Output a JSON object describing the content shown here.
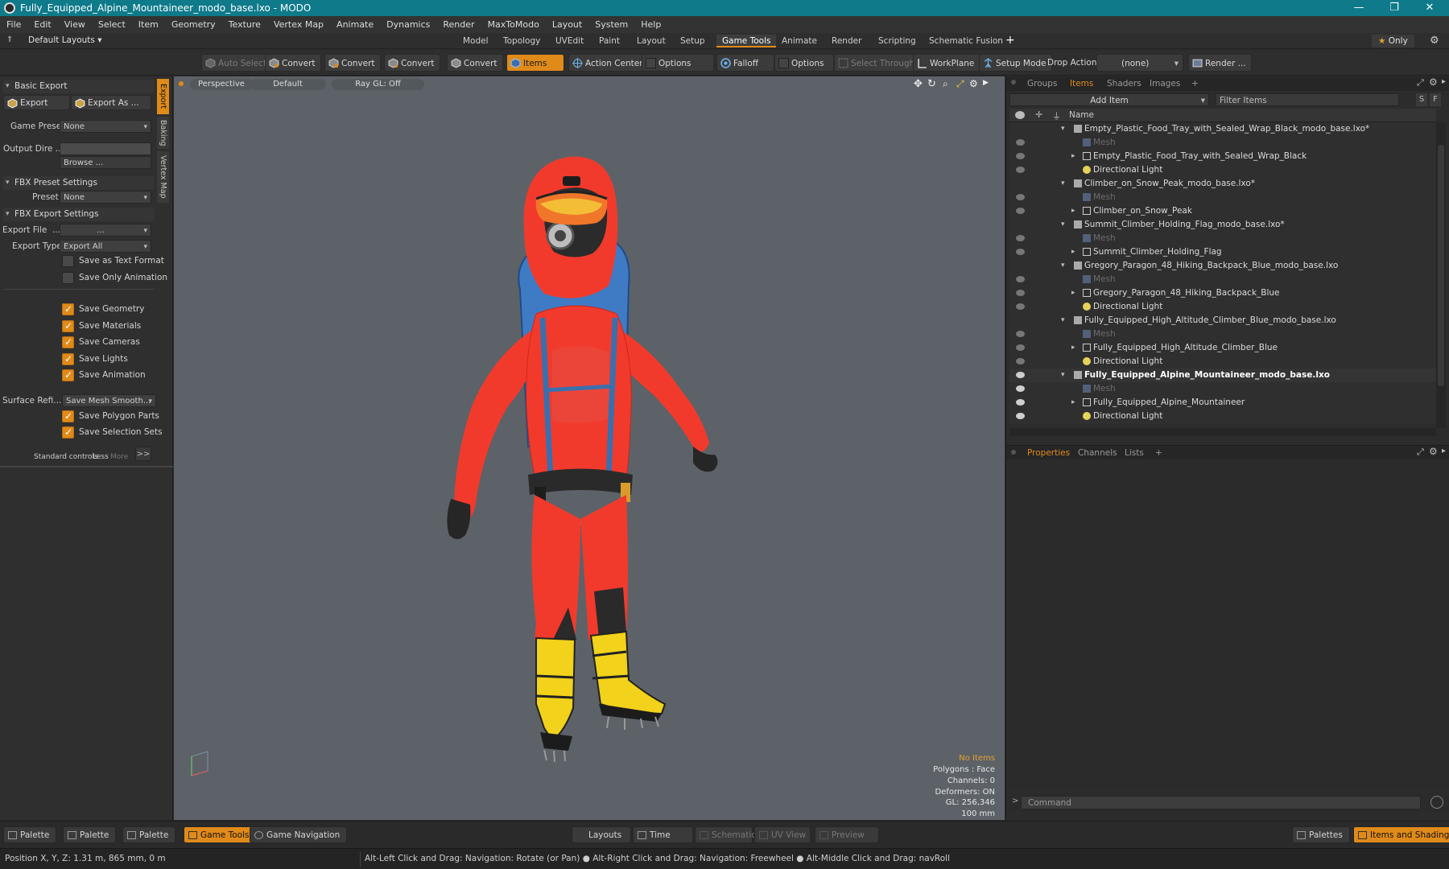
{
  "window": {
    "title": "Fully_Equipped_Alpine_Mountaineer_modo_base.lxo - MODO",
    "controls": [
      "—",
      "❐",
      "✕"
    ]
  },
  "menu": [
    "File",
    "Edit",
    "View",
    "Select",
    "Item",
    "Geometry",
    "Texture",
    "Vertex Map",
    "Animate",
    "Dynamics",
    "Render",
    "MaxToModo",
    "Layout",
    "System",
    "Help"
  ],
  "layouts": {
    "dropdown": "Default Layouts",
    "tabs": [
      "Model",
      "Topology",
      "UVEdit",
      "Paint",
      "Layout",
      "Setup",
      "Game Tools",
      "Animate",
      "Render",
      "Scripting",
      "Schematic Fusion"
    ],
    "active_tab": "Game Tools",
    "only": "Only"
  },
  "toolbar": {
    "auto_select": "Auto Select",
    "convert": "Convert",
    "items": "Items",
    "action_center": "Action Center",
    "options": "Options",
    "falloff": "Falloff",
    "select_through": "Select Through",
    "workplane": "WorkPlane",
    "setup_mode": "Setup Mode",
    "drop_action": "Drop Action",
    "drop_value": "(none)",
    "render": "Render ..."
  },
  "left": {
    "basic_export": "Basic Export",
    "export_btn": "Export",
    "export_as_btn": "Export As ...",
    "game_preset_label": "Game Preset",
    "game_preset_value": "None",
    "output_dir_label": "Output Dire ...",
    "browse": "Browse ...",
    "fbx_preset_settings": "FBX Preset Settings",
    "preset_label": "Preset",
    "preset_value": "None",
    "fbx_export_settings": "FBX Export Settings",
    "export_file_label": "Export File",
    "export_file_value": "...",
    "export_type_label": "Export Type",
    "export_type_value": "Export All",
    "save_text_format": "Save as Text Format",
    "save_only_animation": "Save Only Animation",
    "save_geometry": "Save Geometry",
    "save_materials": "Save Materials",
    "save_cameras": "Save Cameras",
    "save_lights": "Save Lights",
    "save_animation": "Save Animation",
    "surface_label": "Surface Refi...",
    "surface_value": "Save Mesh Smooth...",
    "save_polygon_parts": "Save Polygon Parts",
    "save_selection_sets": "Save Selection Sets",
    "standard_controls": "Standard controls",
    "less": "Less",
    "more": "More",
    "vtabs": [
      "Export",
      "Baking",
      "Vertex Map"
    ]
  },
  "viewport": {
    "view": "Perspective",
    "style": "Default",
    "raygl": "Ray GL: Off",
    "info": {
      "no_items": "No Items",
      "polygons": "Polygons : Face",
      "channels": "Channels: 0",
      "deformers": "Deformers: ON",
      "gl": "GL: 256,346",
      "scale": "100 mm"
    }
  },
  "right": {
    "tabs": [
      "Groups",
      "Items",
      "Shaders",
      "Images"
    ],
    "active_tab": "Items",
    "add_item": "Add Item",
    "filter_items": "Filter Items",
    "name_header": "Name",
    "tree": [
      {
        "label": "Empty_Plastic_Food_Tray_with_Sealed_Wrap_Black_modo_base.lxo*",
        "level": 0,
        "type": "scene"
      },
      {
        "label": "Mesh",
        "level": 1,
        "type": "mesh"
      },
      {
        "label": "Empty_Plastic_Food_Tray_with_Sealed_Wrap_Black",
        "level": 1,
        "type": "group"
      },
      {
        "label": "Directional Light",
        "level": 1,
        "type": "light"
      },
      {
        "label": "Climber_on_Snow_Peak_modo_base.lxo*",
        "level": 0,
        "type": "scene"
      },
      {
        "label": "Mesh",
        "level": 1,
        "type": "mesh"
      },
      {
        "label": "Climber_on_Snow_Peak",
        "level": 1,
        "type": "group"
      },
      {
        "label": "Summit_Climber_Holding_Flag_modo_base.lxo*",
        "level": 0,
        "type": "scene"
      },
      {
        "label": "Mesh",
        "level": 1,
        "type": "mesh"
      },
      {
        "label": "Summit_Climber_Holding_Flag",
        "level": 1,
        "type": "group"
      },
      {
        "label": "Gregory_Paragon_48_Hiking_Backpack_Blue_modo_base.lxo",
        "level": 0,
        "type": "scene"
      },
      {
        "label": "Mesh",
        "level": 1,
        "type": "mesh"
      },
      {
        "label": "Gregory_Paragon_48_Hiking_Backpack_Blue",
        "level": 1,
        "type": "group"
      },
      {
        "label": "Directional Light",
        "level": 1,
        "type": "light"
      },
      {
        "label": "Fully_Equipped_High_Altitude_Climber_Blue_modo_base.lxo",
        "level": 0,
        "type": "scene"
      },
      {
        "label": "Mesh",
        "level": 1,
        "type": "mesh"
      },
      {
        "label": "Fully_Equipped_High_Altitude_Climber_Blue",
        "level": 1,
        "type": "group"
      },
      {
        "label": "Directional Light",
        "level": 1,
        "type": "light"
      },
      {
        "label": "Fully_Equipped_Alpine_Mountaineer_modo_base.lxo",
        "level": 0,
        "type": "scene",
        "bold": true
      },
      {
        "label": "Mesh",
        "level": 1,
        "type": "mesh"
      },
      {
        "label": "Fully_Equipped_Alpine_Mountaineer",
        "level": 1,
        "type": "group"
      },
      {
        "label": "Directional Light",
        "level": 1,
        "type": "light"
      }
    ],
    "prop_tabs": [
      "Properties",
      "Channels",
      "Lists"
    ],
    "command_placeholder": "Command"
  },
  "bottom": {
    "palette": "Palette",
    "game_tools": "Game Tools",
    "game_navigation": "Game Navigation",
    "layouts": "Layouts",
    "time": "Time",
    "schematic": "Schematic",
    "uv_view": "UV View",
    "preview": "Preview",
    "palettes": "Palettes",
    "items_shading": "Items and Shading"
  },
  "status": {
    "position": "Position X, Y, Z:   1.31 m, 865 mm, 0 m",
    "hint1": "Alt-Left Click and Drag: Navigation: Rotate (or Pan)",
    "hint2": "Alt-Right Click and Drag: Navigation: Freewheel",
    "hint3": "Alt-Middle Click and Drag: navRoll"
  },
  "colors": {
    "accent": "#e08a1a",
    "titlebar": "#0e7a8a",
    "suit": "#f23a2c",
    "backpack": "#3f7bc4",
    "boots": "#f2d21a",
    "viewport": "#5c6268"
  }
}
